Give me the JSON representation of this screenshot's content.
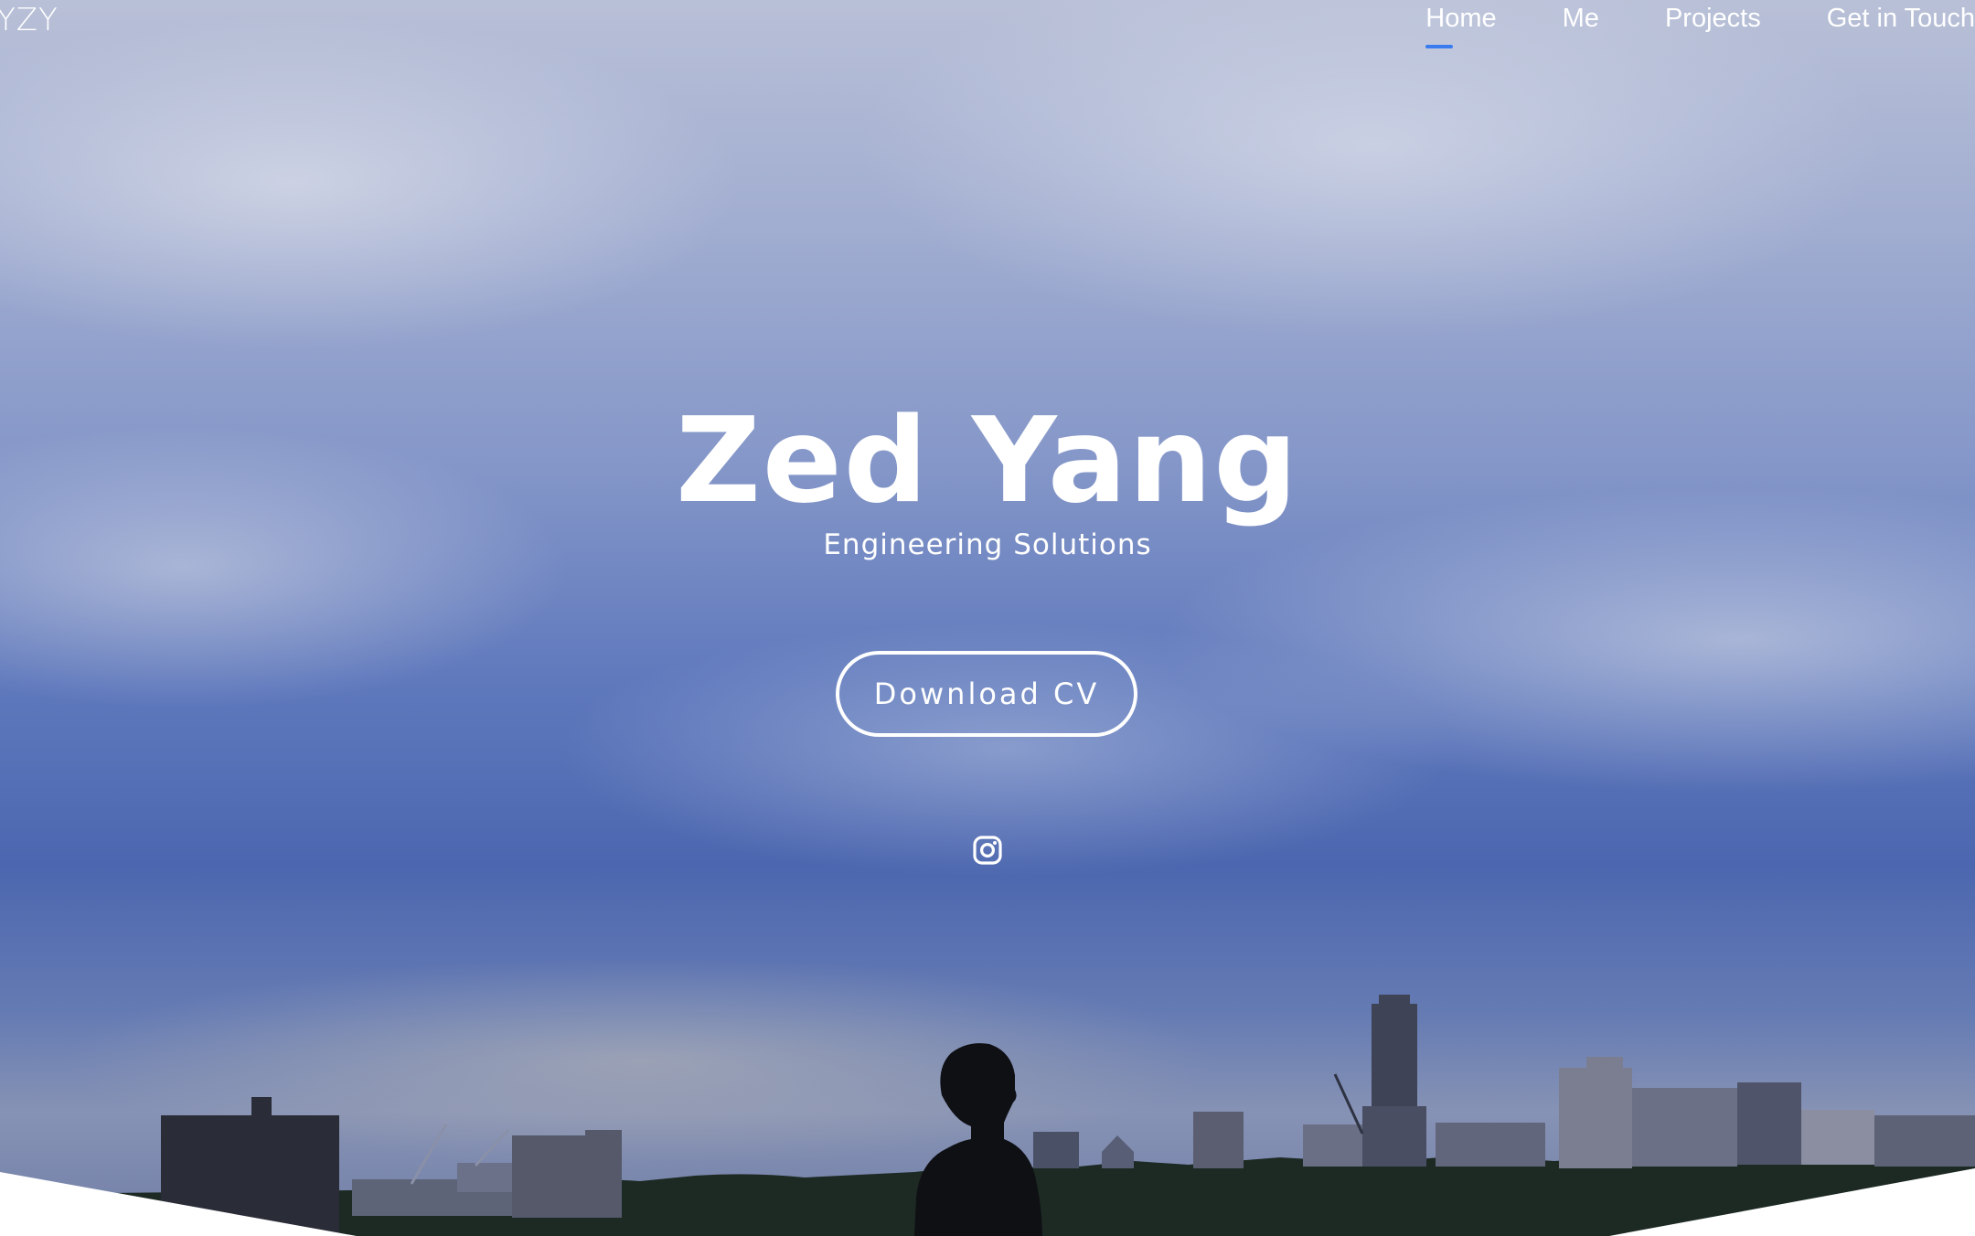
{
  "header": {
    "logo": "YZY",
    "nav": [
      {
        "label": "Home",
        "active": true
      },
      {
        "label": "Me",
        "active": false
      },
      {
        "label": "Projects",
        "active": false
      },
      {
        "label": "Get in Touch",
        "active": false
      }
    ]
  },
  "hero": {
    "name": "Zed Yang",
    "tagline": "Engineering Solutions",
    "cv_button": "Download CV",
    "social_icon": "instagram-icon"
  },
  "colors": {
    "accent": "#3a7cf0",
    "text": "#ffffff"
  }
}
